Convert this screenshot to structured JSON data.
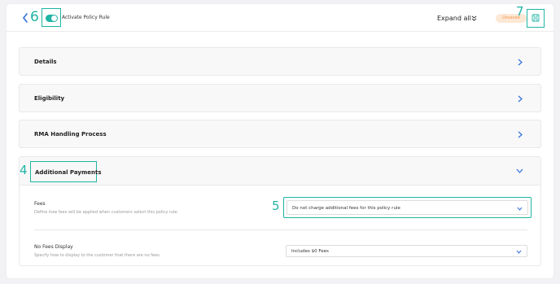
{
  "header": {
    "back_icon": "chevron-left-icon",
    "step_toggle": "6",
    "toggle_label": "Activate Policy Rule",
    "expand_all_label": "Expand all",
    "expand_icon": "expand-chevrons-icon",
    "unsaved_badge": "Unsaved",
    "step_save": "7",
    "save_icon": "save-icon"
  },
  "sections": [
    {
      "title": "Details"
    },
    {
      "title": "Eligibility"
    },
    {
      "title": "RMA Handling Process"
    }
  ],
  "additional_payments": {
    "step": "4",
    "title": "Additional Payments",
    "fees": {
      "label": "Fees",
      "description": "Define how fees will be applied when customers select this policy rule.",
      "step": "5",
      "selected": "Do not charge additional fees for this policy rule"
    },
    "no_fees_display": {
      "label": "No Fees Display",
      "description": "Specify how to display to the customer that there are no fees.",
      "selected": "Includes $0 Fees"
    }
  },
  "colors": {
    "accent": "#1fb4a3",
    "chevron": "#2e6fd8",
    "unsaved_bg": "#fde8d6",
    "unsaved_text": "#f0954a"
  }
}
